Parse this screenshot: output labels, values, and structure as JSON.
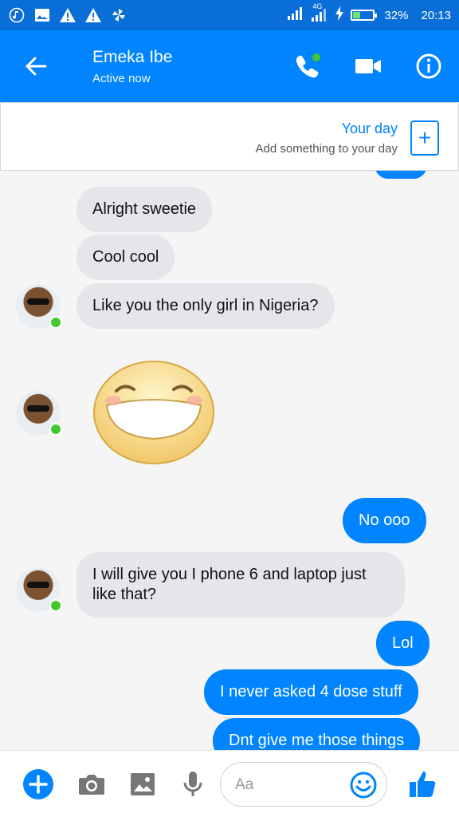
{
  "status_bar": {
    "network": "4G",
    "battery": "32%",
    "battery_level": 0.32,
    "time": "20:13"
  },
  "header": {
    "contact_name": "Emeka Ibe",
    "status": "Active now",
    "icons": [
      "back-arrow-icon",
      "phone-icon",
      "video-icon",
      "info-icon"
    ]
  },
  "your_day": {
    "title": "Your day",
    "subtitle": "Add something to your day",
    "add_symbol": "+"
  },
  "messages": [
    {
      "from": "contact",
      "text": "Alright sweetie"
    },
    {
      "from": "contact",
      "text": "Cool cool"
    },
    {
      "from": "contact",
      "text": "Like you the only girl in Nigeria?"
    },
    {
      "from": "contact",
      "type": "sticker",
      "sticker": "grinning-face"
    },
    {
      "from": "me",
      "text": "No ooo"
    },
    {
      "from": "contact",
      "text": "I will give you I phone 6 and laptop just like that?",
      "line1": "I will give you I phone 6 and laptop just",
      "line2": "like that?"
    },
    {
      "from": "me",
      "text": "Lol"
    },
    {
      "from": "me",
      "text": "I never asked 4 dose stuff"
    },
    {
      "from": "me",
      "text": "Dnt give me those things"
    }
  ],
  "composer": {
    "placeholder": "Aa",
    "icons": [
      "add-icon",
      "camera-icon",
      "gallery-icon",
      "mic-icon",
      "emoji-icon",
      "like-icon"
    ]
  },
  "colors": {
    "status_bar": "#0a6ed8",
    "brand": "#0084ff",
    "incoming_bubble": "#e5e5ea",
    "online_dot": "#42c92e"
  }
}
